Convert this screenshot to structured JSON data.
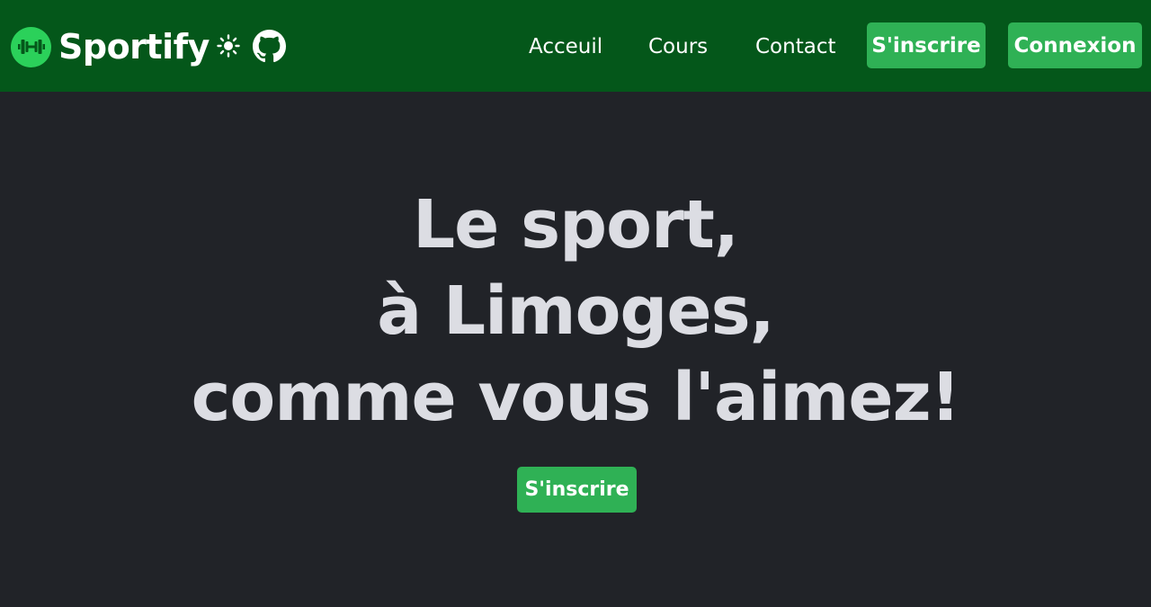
{
  "navbar": {
    "brand_name": "Sportify",
    "logo_icon": "dumbbell-icon",
    "theme_icon": "sun-icon",
    "github_icon": "github-icon",
    "links": [
      {
        "label": "Acceuil"
      },
      {
        "label": "Cours"
      },
      {
        "label": "Contact"
      }
    ],
    "signup_label": "S'inscrire",
    "login_label": "Connexion"
  },
  "hero": {
    "title_lines": [
      "Le sport,",
      "à Limoges,",
      "comme vous l'aimez!"
    ],
    "cta_label": "S'inscrire"
  },
  "colors": {
    "navbar_bg": "#04571a",
    "page_bg": "#212328",
    "accent_green": "#2fb155",
    "logo_green": "#2bd15a",
    "hero_text": "#dcdde3"
  }
}
